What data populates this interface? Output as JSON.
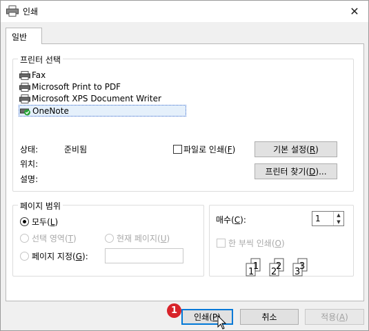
{
  "window": {
    "title": "인쇄",
    "close_glyph": "✕",
    "icon": "printer-icon"
  },
  "tab": {
    "label": "일반"
  },
  "printer_group": {
    "legend": "프린터 선택",
    "printers": [
      {
        "name": "Fax",
        "icon": "fax-printer-icon"
      },
      {
        "name": "Microsoft Print to PDF",
        "icon": "printer-icon"
      },
      {
        "name": "Microsoft XPS Document Writer",
        "icon": "printer-icon"
      },
      {
        "name": "OneNote",
        "icon": "default-printer-check-icon",
        "selected": true
      }
    ],
    "status_label": "상태:",
    "status_value": "준비됨",
    "location_label": "위치:",
    "comment_label": "설명:",
    "print_to_file": {
      "prefix": "파일로 인쇄(",
      "key": "F",
      "suffix": ")",
      "checked": false
    },
    "preferences_button": {
      "prefix": "기본 설정(",
      "key": "R",
      "suffix": ")"
    },
    "find_printer_button": {
      "prefix": "프린터 찾기(",
      "key": "D",
      "suffix": ")..."
    }
  },
  "page_range": {
    "legend": "페이지 범위",
    "all": {
      "prefix": "모두(",
      "key": "L",
      "suffix": ")",
      "checked": true
    },
    "selection": {
      "prefix": "선택 영역(",
      "key": "T",
      "suffix": ")",
      "enabled": false
    },
    "current_page": {
      "prefix": "현재 페이지(",
      "key": "U",
      "suffix": ")",
      "enabled": false
    },
    "pages": {
      "prefix": "페이지 지정(",
      "key": "G",
      "suffix": "):",
      "value": ""
    }
  },
  "copies": {
    "label_prefix": "매수(",
    "label_key": "C",
    "label_suffix": "):",
    "value": "1",
    "collate": {
      "prefix": "한 부씩 인쇄(",
      "key": "O",
      "suffix": ")",
      "checked": false,
      "enabled": false
    },
    "collate_pages": [
      "1",
      "1",
      "2",
      "2",
      "3",
      "3"
    ]
  },
  "buttons": {
    "print": {
      "prefix": "인쇄(",
      "key": "P",
      "suffix": ")"
    },
    "cancel": {
      "label": "취소"
    },
    "apply": {
      "prefix": "적용(",
      "key": "A",
      "suffix": ")",
      "enabled": false
    }
  },
  "annotation": {
    "step": "1"
  },
  "colors": {
    "accent": "#0078d7",
    "badge": "#d8232a",
    "selection_bg": "#e5f0fb"
  }
}
